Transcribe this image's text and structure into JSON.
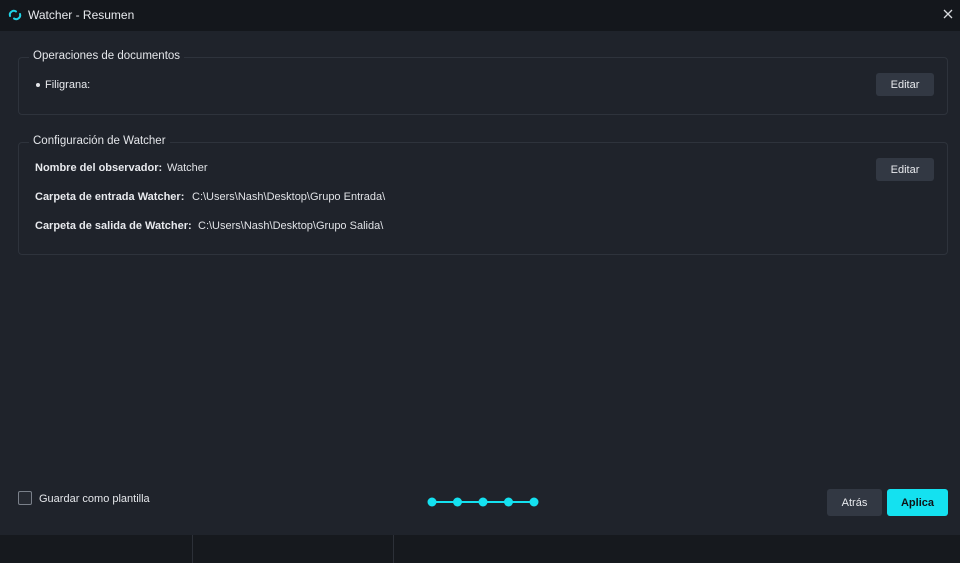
{
  "window": {
    "title": "Watcher - Resumen",
    "app_icon": "watcher-sync-icon",
    "close_icon": "close-icon"
  },
  "document_operations": {
    "title": "Operaciones de documentos",
    "watermark_label": "Filigrana:",
    "edit_label": "Editar"
  },
  "watcher_config": {
    "title": "Configuración de Watcher",
    "observer_name_label": "Nombre del observador:",
    "observer_name_value": "Watcher",
    "input_folder_label": "Carpeta de entrada Watcher:",
    "input_folder_value": "C:\\Users\\Nash\\Desktop\\Grupo Entrada\\",
    "output_folder_label": "Carpeta de salida de Watcher:",
    "output_folder_value": "C:\\Users\\Nash\\Desktop\\Grupo Salida\\",
    "edit_label": "Editar"
  },
  "footer": {
    "save_template_label": "Guardar como plantilla",
    "save_template_checked": false,
    "steps_total": 5,
    "steps_completed": 5,
    "back_label": "Atrás",
    "apply_label": "Aplica"
  },
  "colors": {
    "accent": "#14e1f0",
    "background": "#1f232b",
    "titlebar": "#14171c",
    "button": "#323843"
  }
}
